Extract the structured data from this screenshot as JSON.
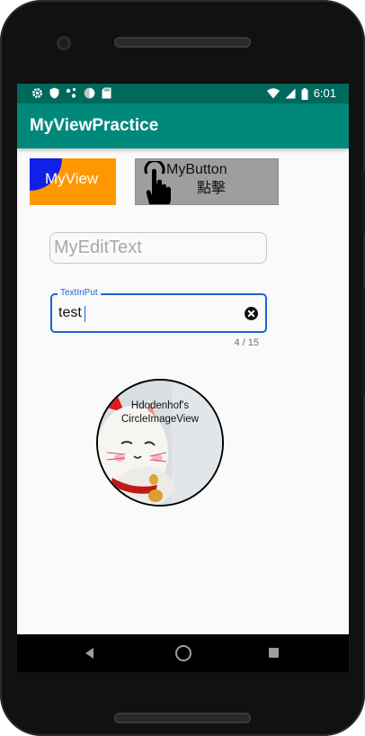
{
  "status_bar": {
    "time": "6:01",
    "left_icons": [
      "settings-icon",
      "shield-icon",
      "dots-icon",
      "circle-icon",
      "sd-card-icon"
    ],
    "right_icons": [
      "wifi-icon",
      "signal-icon",
      "battery-icon"
    ]
  },
  "app_bar": {
    "title": "MyViewPractice",
    "color": "#00897b",
    "status_color": "#00695c"
  },
  "my_view": {
    "label": "MyView",
    "bg_color": "#ff9800",
    "circle_color": "#1020e8"
  },
  "my_button": {
    "label_line1": "MyButton",
    "label_line2": "點擊",
    "icon": "touch-icon"
  },
  "my_edit_text": {
    "placeholder": "MyEditText",
    "value": ""
  },
  "text_input": {
    "label": "TextInPut",
    "value": "test",
    "counter": "4 / 15",
    "end_icon": "clear-icon",
    "accent": "#1e63d8"
  },
  "circle_image": {
    "caption_line1": "Hdodenhof's",
    "caption_line2": "CircleImageView"
  },
  "nav_bar": {
    "icons": [
      "back-icon",
      "home-icon",
      "recents-icon"
    ]
  }
}
